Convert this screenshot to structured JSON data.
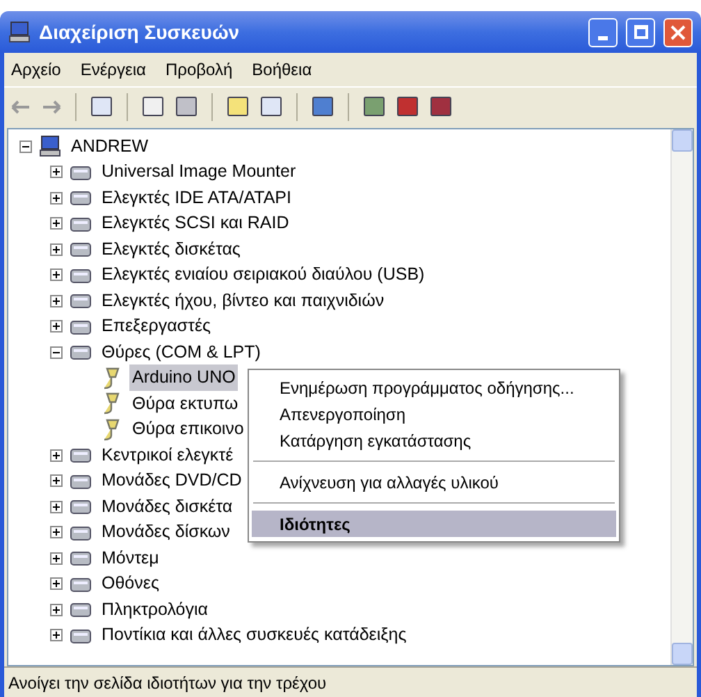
{
  "window": {
    "title": "Διαχείριση Συσκευών"
  },
  "menu_bar": [
    "Αρχείο",
    "Ενέργεια",
    "Προβολή",
    "Βοήθεια"
  ],
  "tree": {
    "label": "ANDREW",
    "expanded": true,
    "selected": false,
    "children": [
      {
        "label": "Universal Image Mounter",
        "expanded": false,
        "selected": false
      },
      {
        "label": "Ελεγκτές IDE ATA/ATAPI",
        "expanded": false,
        "selected": false
      },
      {
        "label": "Ελεγκτές SCSI και RAID",
        "expanded": false,
        "selected": false
      },
      {
        "label": "Ελεγκτές δισκέτας",
        "expanded": false,
        "selected": false
      },
      {
        "label": "Ελεγκτές ενιαίου σειριακού διαύλου (USB)",
        "expanded": false,
        "selected": false
      },
      {
        "label": "Ελεγκτές ήχου, βίντεο και παιχνιδιών",
        "expanded": false,
        "selected": false
      },
      {
        "label": "Επεξεργαστές",
        "expanded": false,
        "selected": false
      },
      {
        "label": "Θύρες (COM & LPT)",
        "expanded": true,
        "selected": false,
        "children": [
          {
            "label": "Arduino UNO",
            "selected": true
          },
          {
            "label": "Θύρα εκτυπω",
            "selected": false
          },
          {
            "label": "Θύρα επικοινο",
            "selected": false
          }
        ]
      },
      {
        "label": "Κεντρικοί ελεγκτέ",
        "expanded": false,
        "selected": false
      },
      {
        "label": "Μονάδες DVD/CD",
        "expanded": false,
        "selected": false
      },
      {
        "label": "Μονάδες δισκέτα",
        "expanded": false,
        "selected": false
      },
      {
        "label": "Μονάδες δίσκων",
        "expanded": false,
        "selected": false
      },
      {
        "label": "Μόντεμ",
        "expanded": false,
        "selected": false
      },
      {
        "label": "Οθόνες",
        "expanded": false,
        "selected": false
      },
      {
        "label": "Πληκτρολόγια",
        "expanded": false,
        "selected": false
      },
      {
        "label": "Ποντίκια και άλλες συσκευές κατάδειξης",
        "expanded": false,
        "selected": false
      }
    ]
  },
  "context_menu": [
    {
      "kind": "item",
      "label": "Ενημέρωση προγράμματος οδήγησης...",
      "selected": false
    },
    {
      "kind": "item",
      "label": "Απενεργοποίηση",
      "selected": false
    },
    {
      "kind": "item",
      "label": "Κατάργηση εγκατάστασης",
      "selected": false
    },
    {
      "kind": "separator"
    },
    {
      "kind": "item",
      "label": "Ανίχνευση για αλλαγές υλικού",
      "selected": false
    },
    {
      "kind": "separator"
    },
    {
      "kind": "item",
      "label": "Ιδιότητες",
      "selected": true
    }
  ],
  "status_bar": "Ανοίγει την σελίδα ιδιοτήτων για την τρέχου"
}
